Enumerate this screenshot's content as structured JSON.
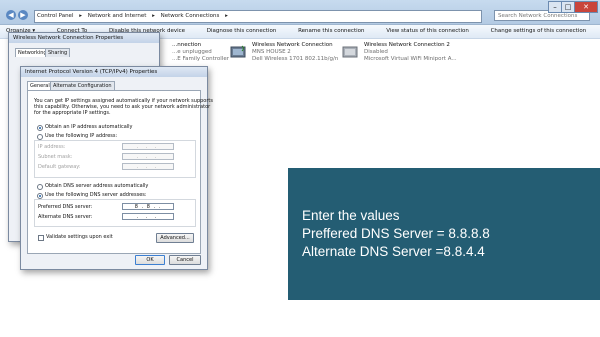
{
  "window": {
    "address_parts": [
      "Control Panel",
      "▸",
      "Network and Internet",
      "▸",
      "Network Connections",
      "▸"
    ],
    "search_placeholder": "Search Network Connections",
    "toolbar": [
      "Organize ▾",
      "Connect To",
      "Disable this network device",
      "Diagnose this connection",
      "Rename this connection",
      "View status of this connection",
      "Change settings of this connection"
    ],
    "connections": [
      {
        "name": "...nnection",
        "status": "...e unplugged",
        "device": "...E Family Controller"
      },
      {
        "name": "Wireless Network Connection",
        "status": "MNS HOUSE  2",
        "device": "Dell Wireless 1701 802.11b/g/n"
      },
      {
        "name": "Wireless Network Connection 2",
        "status": "Disabled",
        "device": "Microsoft Virtual WiFi Miniport A..."
      }
    ]
  },
  "wncp": {
    "title": "Wireless Network Connection Properties",
    "tabs": [
      "Networking",
      "Sharing"
    ]
  },
  "ipv4": {
    "title": "Internet Protocol Version 4 (TCP/IPv4) Properties",
    "tabs": [
      "General",
      "Alternate Configuration"
    ],
    "description": [
      "You can get IP settings assigned automatically if your network supports",
      "this capability. Otherwise, you need to ask your network administrator",
      "for the appropriate IP settings."
    ],
    "obtain_ip_auto": "Obtain an IP address automatically",
    "use_ip": "Use the following IP address:",
    "ip_address_label": "IP address:",
    "subnet_label": "Subnet mask:",
    "gateway_label": "Default gateway:",
    "obtain_dns_auto": "Obtain DNS server address automatically",
    "use_dns": "Use the following DNS server addresses:",
    "preferred_dns_label": "Preferred DNS server:",
    "alternate_dns_label": "Alternate DNS server:",
    "preferred_dns_value": "8 .  8 .   .",
    "empty_ip": ".   .   .",
    "validate_label": "Validate settings upon exit",
    "advanced_button": "Advanced...",
    "ok_button": "OK",
    "cancel_button": "Cancel"
  },
  "overlay": {
    "line1": "Enter the values",
    "line2": "Preffered DNS Server = 8.8.8.8",
    "line3": "Alternate DNS Server =8.8.4.4"
  },
  "colors": {
    "overlay_bg": "#245d73",
    "selection_blue": "#1c5fa8"
  }
}
